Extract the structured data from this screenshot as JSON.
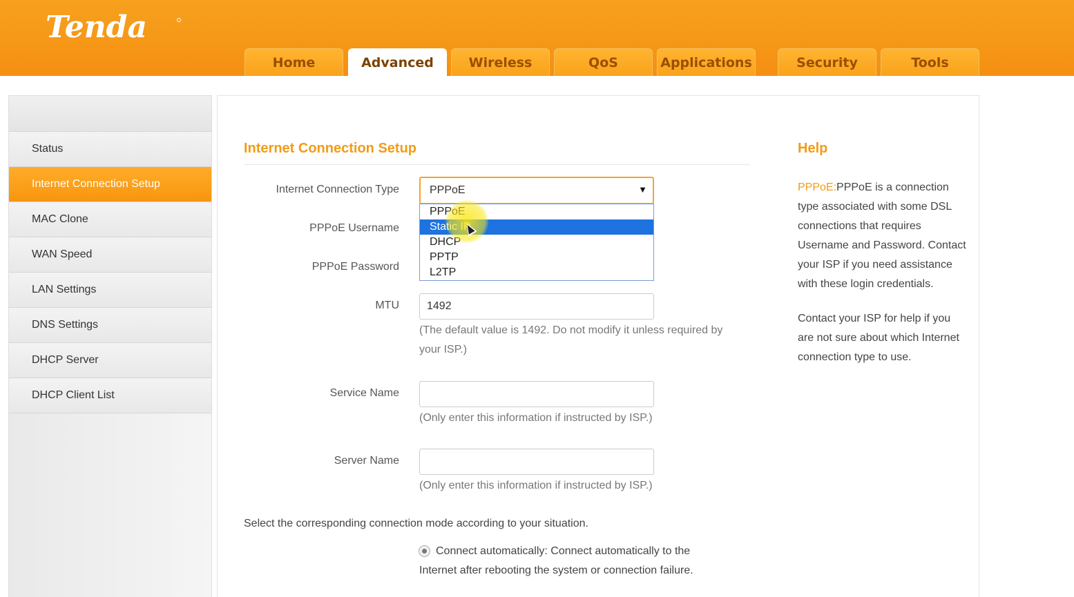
{
  "brand": {
    "logo_text": "Tenda"
  },
  "nav": {
    "tabs": [
      {
        "label": "Home"
      },
      {
        "label": "Advanced"
      },
      {
        "label": "Wireless"
      },
      {
        "label": "QoS"
      },
      {
        "label": "Applications"
      },
      {
        "label": "Security"
      },
      {
        "label": "Tools"
      }
    ],
    "active": "Advanced"
  },
  "sidebar": {
    "items": [
      {
        "label": "Status"
      },
      {
        "label": "Internet Connection Setup"
      },
      {
        "label": "MAC Clone"
      },
      {
        "label": "WAN Speed"
      },
      {
        "label": "LAN Settings"
      },
      {
        "label": "DNS Settings"
      },
      {
        "label": "DHCP Server"
      },
      {
        "label": "DHCP Client List"
      }
    ],
    "active": "Internet Connection Setup"
  },
  "main": {
    "title": "Internet Connection Setup",
    "connection_type": {
      "label": "Internet Connection Type",
      "value": "PPPoE",
      "options": [
        "PPPoE",
        "Static IP",
        "DHCP",
        "PPTP",
        "L2TP"
      ],
      "highlighted": "Static IP"
    },
    "username": {
      "label": "PPPoE Username"
    },
    "password": {
      "label": "PPPoE Password"
    },
    "mtu": {
      "label": "MTU",
      "value": "1492",
      "hint": "(The default value is 1492. Do not modify it unless required by your ISP.)"
    },
    "service_name": {
      "label": "Service Name",
      "value": "",
      "hint": "(Only enter this information if instructed by ISP.)"
    },
    "server_name": {
      "label": "Server Name",
      "value": "",
      "hint": "(Only enter this information if instructed by ISP.)"
    },
    "mode_instruction": "Select the corresponding connection mode according to your situation.",
    "mode_option": "Connect automatically: Connect automatically to the Internet after rebooting the system or connection failure."
  },
  "help": {
    "title": "Help",
    "key": "PPPoE:",
    "p1": "PPPoE is a connection type associated with some DSL connections that requires Username and Password. Contact your ISP if you need assistance with these login credentials.",
    "p2": "Contact your ISP for help if you are not sure about which Internet connection type to use."
  },
  "colors": {
    "brand_orange": "#f7a11e",
    "accent_text": "#f39b16",
    "highlight_blue": "#1e73e0"
  }
}
